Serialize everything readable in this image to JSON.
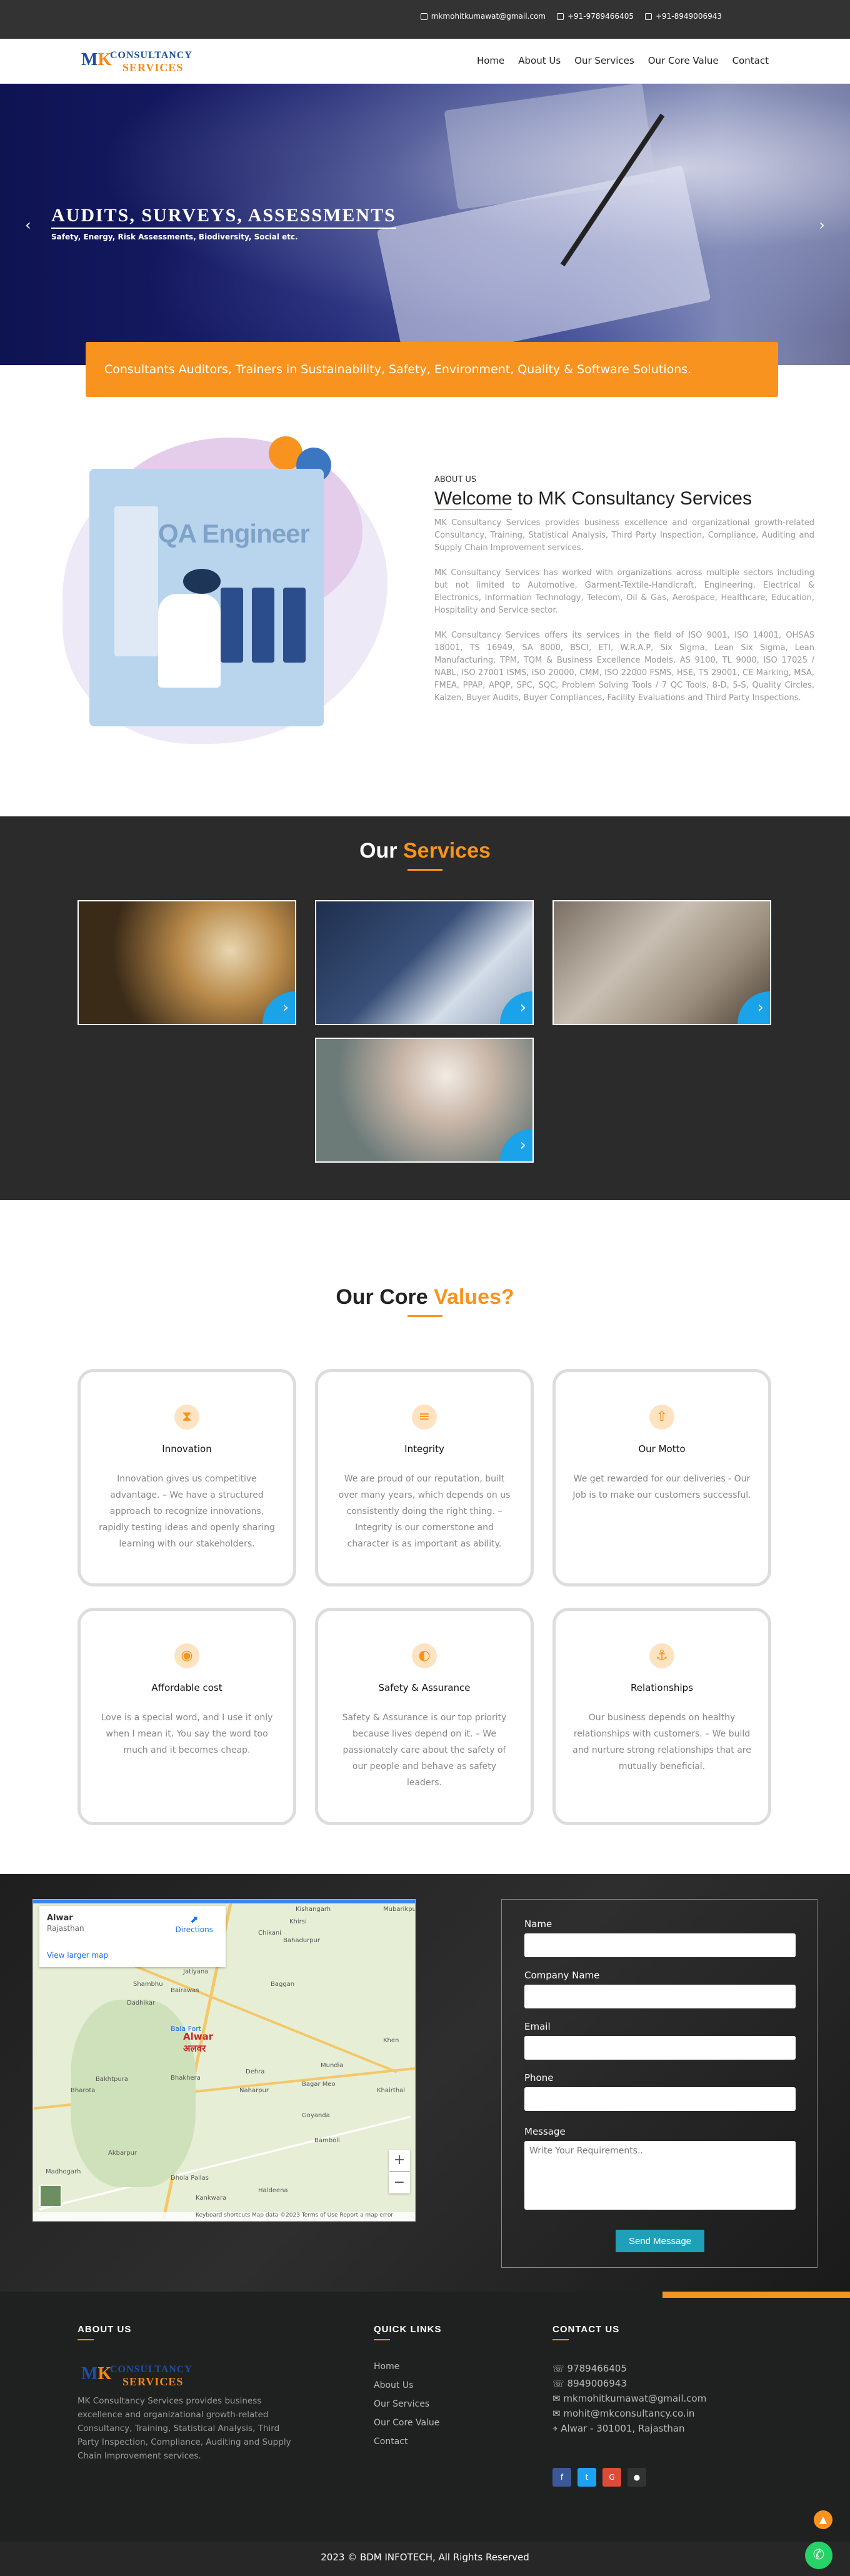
{
  "topbar": {
    "email": "mkmohitkumawat@gmail.com",
    "phone1": "+91-9789466405",
    "phone2": "+91-8949006943"
  },
  "nav": {
    "logo": {
      "mk": "MK",
      "cons": "CONSULTANCY",
      "serv": "SERVICES"
    },
    "items": [
      "Home",
      "About Us",
      "Our Services",
      "Our Core Value",
      "Contact"
    ]
  },
  "hero": {
    "title": "AUDITS, SURVEYS, ASSESSMENTS",
    "subtitle": "Safety, Energy, Risk Assessments, Biodiversity, Social etc.",
    "prev_icon": "chevron-left-icon",
    "next_icon": "chevron-right-icon"
  },
  "banner": {
    "text": "Consultants Auditors, Trainers in Sustainability, Safety, Environment, Quality & Software Solutions."
  },
  "about": {
    "label": "ABOUT US",
    "title_first": "Welcome",
    "title_rest": " to MK Consultancy Services",
    "image_text": "QA Engineer",
    "paragraphs": [
      "MK Consultancy Services provides business excellence and organizational growth-related Consultancy, Training, Statistical Analysis, Third Party Inspection, Compliance, Auditing and Supply Chain Improvement services.",
      "MK Consultancy Services has worked with organizations across multiple sectors including but not limited to Automotive, Garment-Textile-Handicraft, Engineering, Electrical & Electronics, Information Technology, Telecom, Oil & Gas, Aerospace, Healthcare, Education, Hospitality and Service sector.",
      "MK Consultancy Services offers its services in the field of ISO 9001, ISO 14001, OHSAS 18001, TS 16949, SA 8000, BSCI, ETI, W.R.A.P, Six Sigma, Lean Six Sigma, Lean Manufacturing, TPM, TQM & Business Excellence Models, AS 9100, TL 9000, ISO 17025 / NABL, ISO 27001 ISMS, ISO 20000, CMM, ISO 22000 FSMS, HSE, TS 29001, CE Marking, MSA, FMEA, PPAP, APQP, SPC, SQC, Problem Solving Tools / 7 QC Tools, 8-D, 5-S, Quality Circles, Kaizen, Buyer Audits, Buyer Compliances, Facility Evaluations and Third Party Inspections."
    ]
  },
  "services": {
    "title_a": "Our",
    "title_b": "Services",
    "card_icon": "chevron-right-icon",
    "cards": [
      "planning",
      "magnifier-review",
      "office-meeting",
      "checklist-survey"
    ]
  },
  "core": {
    "title_a": "Our Core",
    "title_b": "Values?",
    "values": [
      {
        "icon": "hourglass-icon",
        "glyph": "⧗",
        "title": "Innovation",
        "text": "Innovation gives us competitive advantage. – We have a structured approach to recognize innovations, rapidly testing ideas and openly sharing learning with our stakeholders."
      },
      {
        "icon": "database-icon",
        "glyph": "≡",
        "title": "Integrity",
        "text": "We are proud of our reputation, built over many years, which depends on us consistently doing the right thing. – Integrity is our cornerstone and character is as important as ability."
      },
      {
        "icon": "upload-icon",
        "glyph": "⇧",
        "title": "Our Motto",
        "text": "We get rewarded for our deliveries - Our Job is to make our customers successful."
      },
      {
        "icon": "camera-icon",
        "glyph": "◉",
        "title": "Affordable cost",
        "text": "Love is a special word, and I use it only when I mean it. You say the word too much and it becomes cheap."
      },
      {
        "icon": "globe-icon",
        "glyph": "◐",
        "title": "Safety & Assurance",
        "text": "Safety & Assurance is our top priority because lives depend on it. – We passionately care about the safety of our people and behave as safety leaders."
      },
      {
        "icon": "anchor-icon",
        "glyph": "⚓",
        "title": "Relationships",
        "text": "Our business depends on healthy relationships with customers. – We build and nurture strong relationships that are mutually beneficial."
      }
    ]
  },
  "contact": {
    "map": {
      "place": "Alwar",
      "region": "Rajasthan",
      "directions": "Directions",
      "view_larger": "View larger map",
      "city_label": "Alwar",
      "city_label_hi": "अलवर",
      "places": [
        "Kishangarh",
        "Khirsi",
        "Chikani",
        "Bahadurpur",
        "Mubarikpur",
        "Jatiyana",
        "Bairawas",
        "Baggan",
        "Shambhu",
        "Dadhikar",
        "Bala Fort",
        "Bakhtpura",
        "Bhakhera",
        "Dehra",
        "Bharota",
        "Naharpur",
        "Mundia",
        "Bagar Meo",
        "Khairthal",
        "Bamboli",
        "Akbarpur",
        "Madhogarh",
        "Dhola Pailas",
        "Kankwara",
        "Haldeena",
        "Goyanda",
        "Khen"
      ],
      "footer_text": "Keyboard shortcuts   Map data ©2023   Terms of Use   Report a map error",
      "zoom_in": "+",
      "zoom_out": "−"
    },
    "form": {
      "name": "Name",
      "company": "Company Name",
      "email": "Email",
      "phone": "Phone",
      "message": "Message",
      "message_placeholder": "Write Your Requirements..",
      "send": "Send Message"
    }
  },
  "footer": {
    "about_heading": "ABOUT US",
    "about_text": "MK Consultancy Services provides business excellence and organizational growth-related Consultancy, Training, Statistical Analysis, Third Party Inspection, Compliance, Auditing and Supply Chain Improvement services.",
    "links_heading": "QUICK LINKS",
    "links": [
      "Home",
      "About Us",
      "Our Services",
      "Our Core Value",
      "Contact"
    ],
    "contact_heading": "CONTACT US",
    "contacts": [
      "9789466405",
      "8949006943",
      "mkmohitkumawat@gmail.com",
      "mohit@mkconsultancy.co.in",
      "Alwar - 301001, Rajasthan"
    ],
    "social": [
      {
        "name": "facebook-icon",
        "glyph": "f",
        "color": "#3b5998"
      },
      {
        "name": "twitter-icon",
        "glyph": "t",
        "color": "#1da1f2"
      },
      {
        "name": "google-plus-icon",
        "glyph": "G",
        "color": "#dd4b39"
      },
      {
        "name": "github-icon",
        "glyph": "●",
        "color": "#333333"
      }
    ],
    "copyright": "2023 © BDM INFOTECH, All Rights Reserved"
  },
  "colors": {
    "accent": "#f7931e",
    "dark": "#2b2b2b",
    "link_blue": "#1aa3e8",
    "send_button": "#20a0b8"
  }
}
